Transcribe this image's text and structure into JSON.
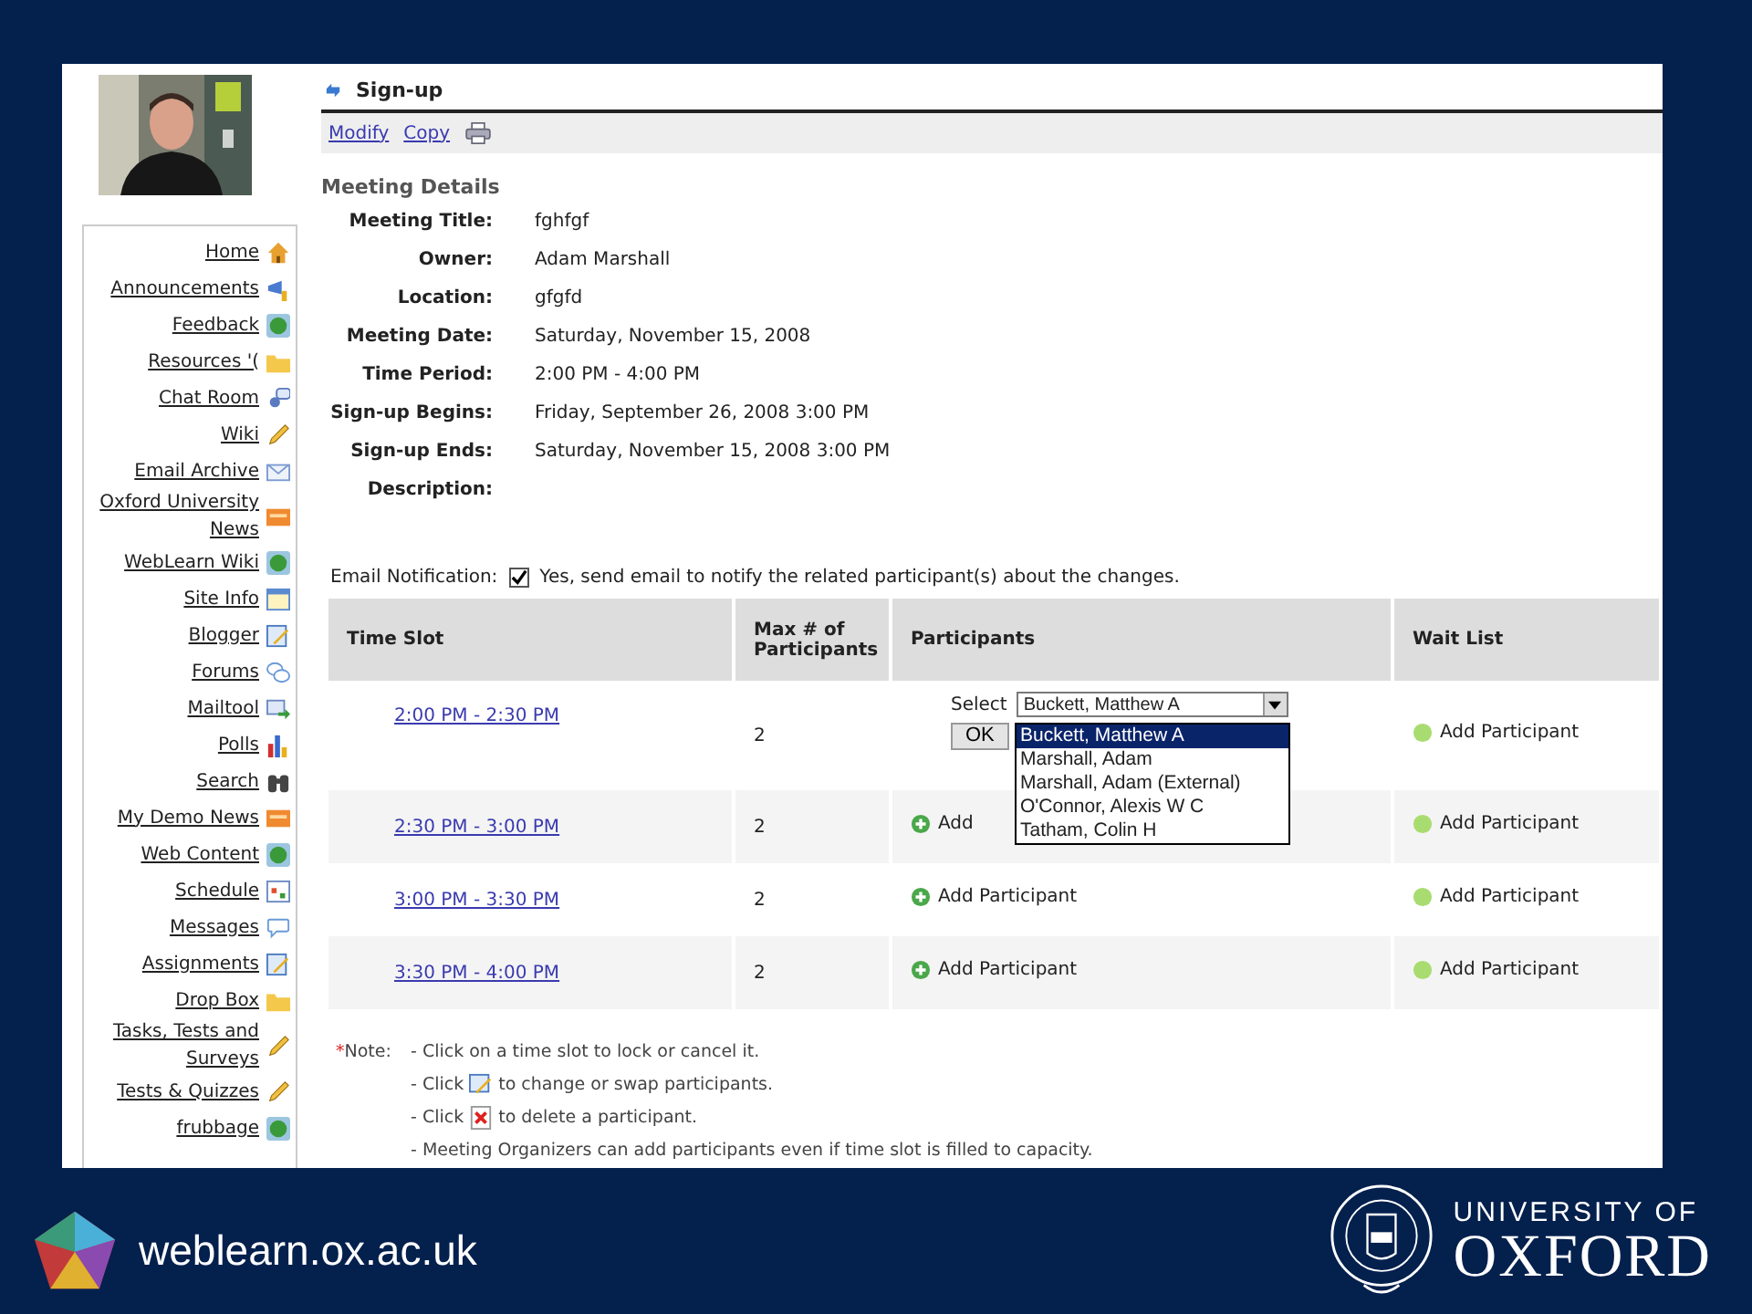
{
  "sidebar": {
    "items": [
      {
        "label": "Home"
      },
      {
        "label": "Announcements"
      },
      {
        "label": "Feedback"
      },
      {
        "label": "Resources '("
      },
      {
        "label": "Chat Room"
      },
      {
        "label": "Wiki"
      },
      {
        "label": "Email Archive"
      },
      {
        "label": "Oxford University News"
      },
      {
        "label": "WebLearn Wiki"
      },
      {
        "label": "Site Info"
      },
      {
        "label": "Blogger"
      },
      {
        "label": "Forums"
      },
      {
        "label": "Mailtool"
      },
      {
        "label": "Polls"
      },
      {
        "label": "Search"
      },
      {
        "label": "My Demo News"
      },
      {
        "label": "Web Content"
      },
      {
        "label": "Schedule"
      },
      {
        "label": "Messages"
      },
      {
        "label": "Assignments"
      },
      {
        "label": "Drop Box"
      },
      {
        "label": "Tasks, Tests and Surveys"
      },
      {
        "label": "Tests & Quizzes"
      },
      {
        "label": "frubbage"
      }
    ]
  },
  "page": {
    "title": "Sign-up",
    "toolbar": [
      "Modify",
      "Copy"
    ],
    "section": "Meeting Details",
    "details": [
      {
        "label": "Meeting Title:",
        "value": "fghfgf"
      },
      {
        "label": "Owner:",
        "value": "Adam Marshall"
      },
      {
        "label": "Location:",
        "value": "gfgfd"
      },
      {
        "label": "Meeting Date:",
        "value": "Saturday, November 15, 2008"
      },
      {
        "label": "Time Period:",
        "value": "2:00 PM - 4:00 PM"
      },
      {
        "label": "Sign-up Begins:",
        "value": "Friday, September 26, 2008 3:00 PM"
      },
      {
        "label": "Sign-up Ends:",
        "value": "Saturday, November 15, 2008 3:00 PM"
      },
      {
        "label": "Description:"
      }
    ]
  },
  "email_notification": {
    "label": "Email Notification:",
    "checked": true,
    "text": "Yes, send email to notify the related participant(s) about the changes."
  },
  "table": {
    "columns": [
      "Time Slot",
      "Max # of Participants",
      "Participants",
      "Wait List"
    ],
    "rows": [
      {
        "time_slot": "2:00 PM - 2:30 PM",
        "max": "2",
        "participants": {
          "kind": "select",
          "label": "Select",
          "value": "Buckett, Matthew A",
          "button": "OK",
          "options": [
            {
              "text": "Buckett, Matthew A",
              "selected": true
            },
            {
              "text": "Marshall, Adam",
              "selected": false
            },
            {
              "text": "Marshall, Adam (External)",
              "selected": false
            },
            {
              "text": "O'Connor, Alexis W C",
              "selected": false
            },
            {
              "text": "Tatham, Colin H",
              "selected": false
            }
          ]
        },
        "wait_list": "Add Participant"
      },
      {
        "time_slot": "2:30 PM - 3:00 PM",
        "max": "2",
        "participants": {
          "kind": "add",
          "text": "Add"
        },
        "wait_list": "Add Participant"
      },
      {
        "time_slot": "3:00 PM - 3:30 PM",
        "max": "2",
        "participants": {
          "kind": "add",
          "text": "Add Participant"
        },
        "wait_list": "Add Participant"
      },
      {
        "time_slot": "3:30 PM - 4:00 PM",
        "max": "2",
        "participants": {
          "kind": "add",
          "text": "Add Participant"
        },
        "wait_list": "Add Participant"
      }
    ]
  },
  "notes": {
    "mark": "*",
    "lead": "Note:",
    "lines": [
      {
        "kind": "text",
        "text": "- Click on a time slot to lock or cancel it."
      },
      {
        "kind": "edit",
        "before": "- Click",
        "after": "to change or swap participants."
      },
      {
        "kind": "delete",
        "before": "- Click",
        "after": "to delete a participant."
      },
      {
        "kind": "text",
        "text": "- Meeting Organizers can add participants even if time slot is filled to capacity."
      }
    ]
  },
  "footer": {
    "site": "weblearn.ox.ac.uk",
    "logo_line1": "UNIVERSITY OF",
    "logo_line2": "OXFORD"
  }
}
